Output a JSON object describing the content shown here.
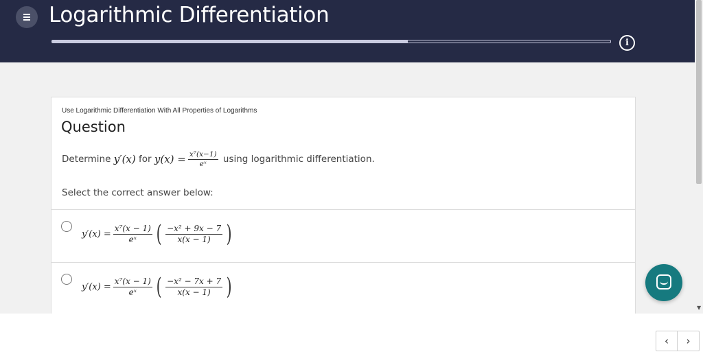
{
  "header": {
    "title": "Logarithmic Differentiation",
    "progress_fraction": 0.637,
    "menu_icon": "menu-icon",
    "info_icon": "info-icon"
  },
  "card": {
    "subtitle": "Use Logarithmic Differentiation With All Properties of Logarithms",
    "heading": "Question",
    "prompt_before": "Determine",
    "prompt_yprime": "y′(x)",
    "prompt_for": "for",
    "prompt_y": "y(x) =",
    "prompt_num": "x⁷(x−1)",
    "prompt_den": "eˣ",
    "prompt_after": "using logarithmic differentiation.",
    "select_label": "Select the correct answer below:"
  },
  "options": [
    {
      "lhs": "y′(x) =",
      "f_num": "x⁷(x − 1)",
      "f_den": "eˣ",
      "p_num": "−x² + 9x − 7",
      "p_den": "x(x − 1)"
    },
    {
      "lhs": "y′(x) =",
      "f_num": "x⁷(x − 1)",
      "f_den": "eˣ",
      "p_num": "−x² − 7x + 7",
      "p_den": "x(x − 1)"
    }
  ],
  "nav": {
    "prev": "‹",
    "next": "›"
  },
  "colors": {
    "header_bg": "#252a45",
    "chat": "#167a7f"
  }
}
